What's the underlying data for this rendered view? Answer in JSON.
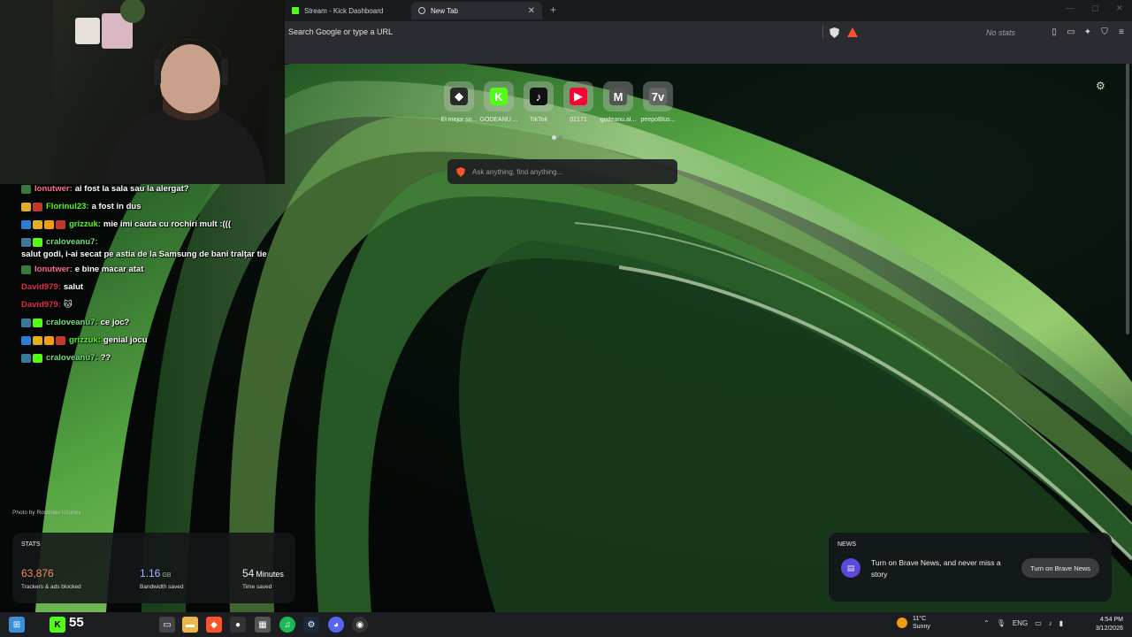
{
  "browser": {
    "tabs": [
      {
        "label": "Stream - Kick Dashboard",
        "active": false
      },
      {
        "label": "New Tab",
        "active": true
      }
    ],
    "address_placeholder": "Search Google or type a URL",
    "shields_text": "No stats",
    "colors": {
      "chrome": "#2b2c31",
      "tabbar": "#1a1b1e",
      "brave_orange": "#fb542b"
    }
  },
  "newtab": {
    "speed_dial": [
      {
        "label": "El mejor so...",
        "icon": "gamepad-icon",
        "glyph": "◆",
        "bg": "#2a2a2a"
      },
      {
        "label": "GODEANU ...",
        "icon": "kick-icon",
        "glyph": "K",
        "bg": "#53fc18"
      },
      {
        "label": "TikTok",
        "icon": "tiktok-icon",
        "glyph": "♪",
        "bg": "#111111"
      },
      {
        "label": "02171",
        "icon": "youtube-icon",
        "glyph": "▶",
        "bg": "#ff0033"
      },
      {
        "label": "godeanu.al...",
        "icon": "gmail-icon",
        "glyph": "M",
        "bg": "#555555"
      },
      {
        "label": "peepoBlus...",
        "icon": "7tv-icon",
        "glyph": "7v",
        "bg": "#666666"
      }
    ],
    "search_placeholder": "Ask anything, find anything...",
    "photo_credit": "Photo by Rostislav Uzunov",
    "stats": {
      "title": "STATS",
      "items": [
        {
          "value": "63,876",
          "unit": "",
          "label": "Trackers & ads blocked",
          "color": "#f28c5b"
        },
        {
          "value": "1.16",
          "unit": "GB",
          "label": "Bandwidth saved",
          "color": "#a8b4ff"
        },
        {
          "value": "54",
          "unit": "Minutes",
          "label": "Time saved",
          "color": "#ffffff"
        }
      ]
    },
    "news": {
      "title": "NEWS",
      "text": "Turn on Brave News, and never miss a story",
      "button": "Turn on Brave News"
    }
  },
  "chat": [
    {
      "badges": [
        "#3a7a3a"
      ],
      "user": "Ionutwer:",
      "user_color": "#ff6b8a",
      "msg": "ai fost la sala sau la alergat?"
    },
    {
      "badges": [
        "#e0b020",
        "#c0392b"
      ],
      "user": "Florinul23:",
      "user_color": "#53fc18",
      "msg": "a fost in dus"
    },
    {
      "badges": [
        "#2d7dd2",
        "#e0b020",
        "#f39c12",
        "#c0392b"
      ],
      "user": "grizzuk:",
      "user_color": "#53fc18",
      "msg": "mie imi cauta cu rochiri mult :((("
    },
    {
      "badges": [
        "#3a7a9a",
        "#53fc18"
      ],
      "user": "craloveanu7:",
      "user_color": "#6ee07a",
      "msg": "salut godi, i-ai secat pe astia de la Samsung de bani tralțar tie",
      "wrap": true
    },
    {
      "badges": [
        "#3a7a3a"
      ],
      "user": "Ionutwer:",
      "user_color": "#ff6b8a",
      "msg": "e bine macar atat"
    },
    {
      "badges": [],
      "user": "David979:",
      "user_color": "#e0304a",
      "msg": "salut"
    },
    {
      "badges": [],
      "user": "David979:",
      "user_color": "#e0304a",
      "msg": "🐱"
    },
    {
      "badges": [
        "#3a7a9a",
        "#53fc18"
      ],
      "user": "craloveanu7:",
      "user_color": "#6ee07a",
      "msg": "ce joc?"
    },
    {
      "badges": [
        "#2d7dd2",
        "#e0b020",
        "#f39c12",
        "#c0392b"
      ],
      "user": "grizzuk:",
      "user_color": "#53fc18",
      "msg": "genial jocu"
    },
    {
      "badges": [
        "#3a7a9a",
        "#53fc18"
      ],
      "user": "craloveanu7:",
      "user_color": "#6ee07a",
      "msg": "??"
    }
  ],
  "taskbar": {
    "count": "55",
    "weather_temp": "11°C",
    "weather_desc": "Sunny",
    "lang": "ENG",
    "time": "4:54 PM",
    "date": "3/12/2026"
  }
}
